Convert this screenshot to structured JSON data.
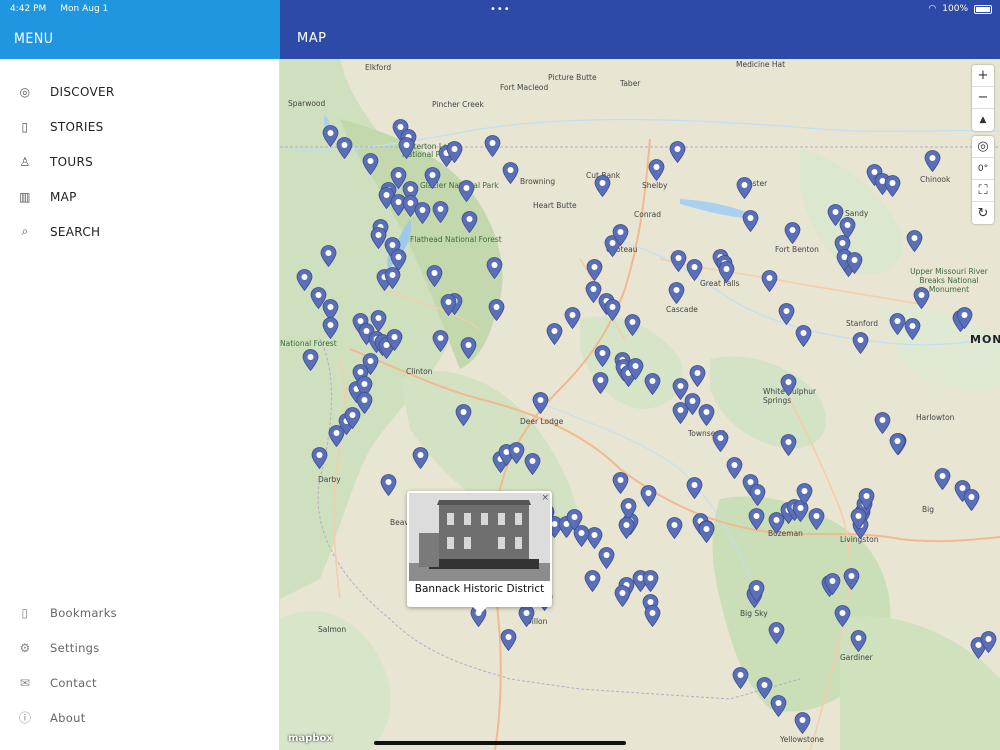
{
  "status": {
    "time": "4:42 PM",
    "date": "Mon Aug 1",
    "battery": "100%",
    "dots": "•••"
  },
  "sidebar": {
    "title": "MENU",
    "primary": [
      {
        "label": "DISCOVER",
        "icon": "compass-icon",
        "glyph": "◎"
      },
      {
        "label": "STORIES",
        "icon": "book-icon",
        "glyph": "▯"
      },
      {
        "label": "TOURS",
        "icon": "walking-icon",
        "glyph": "♙"
      },
      {
        "label": "MAP",
        "icon": "map-icon",
        "glyph": "▥"
      },
      {
        "label": "SEARCH",
        "icon": "search-icon",
        "glyph": "⌕"
      }
    ],
    "secondary": [
      {
        "label": "Bookmarks",
        "icon": "bookmark-icon",
        "glyph": "▯"
      },
      {
        "label": "Settings",
        "icon": "gear-icon",
        "glyph": "⚙"
      },
      {
        "label": "Contact",
        "icon": "envelope-icon",
        "glyph": "✉"
      },
      {
        "label": "About",
        "icon": "info-icon",
        "glyph": "ⓘ"
      }
    ]
  },
  "map": {
    "title": "MAP",
    "popup": {
      "title": "Bannack Historic District",
      "close": "×"
    },
    "logo": "mapbox",
    "controls": {
      "zoom_in": "+",
      "zoom_out": "−",
      "compass": "▲",
      "locate": "◎",
      "bearing": "0°",
      "fullscreen": "⛶",
      "reset": "↻"
    },
    "pin_color": "#5a6fb8",
    "labels": {
      "elkford": "Elkford",
      "sparwood": "Sparwood",
      "pincher_creek": "Pincher Creek",
      "picture_butte": "Picture Butte",
      "fort_macleod": "Fort Macleod",
      "taber": "Taber",
      "medicine_hat": "Medicine Hat",
      "waterton": "Waterton Lakes National Park",
      "glacier": "Glacier National Park",
      "browning": "Browning",
      "cut_bank": "Cut Bank",
      "shelby": "Shelby",
      "chester": "Chester",
      "heart_butte": "Heart Butte",
      "conrad": "Conrad",
      "chinook": "Chinook",
      "choteau": "Choteau",
      "fort_benton": "Fort Benton",
      "great_falls": "Great Falls",
      "flathead": "Flathead National Forest",
      "sandy": "Sandy",
      "breaks": "Upper Missouri River Breaks National Monument",
      "cascade": "Cascade",
      "stanford": "Stanford",
      "clinton": "Clinton",
      "deer_lodge": "Deer Lodge",
      "white_sulphur": "White Sulphur Springs",
      "townsend": "Townsend",
      "harlowton": "Harlowton",
      "darby": "Darby",
      "beaverhead": "Beav",
      "big_timber": "Big",
      "livingston": "Livingston",
      "bozeman": "Bozeman",
      "big_sky": "Big Sky",
      "gardiner": "Gardiner",
      "salmon": "Salmon",
      "dillon": "Dillon",
      "yellowstone": "Yellowstone",
      "national_forest": "National Forest",
      "mont": "MONT"
    }
  }
}
